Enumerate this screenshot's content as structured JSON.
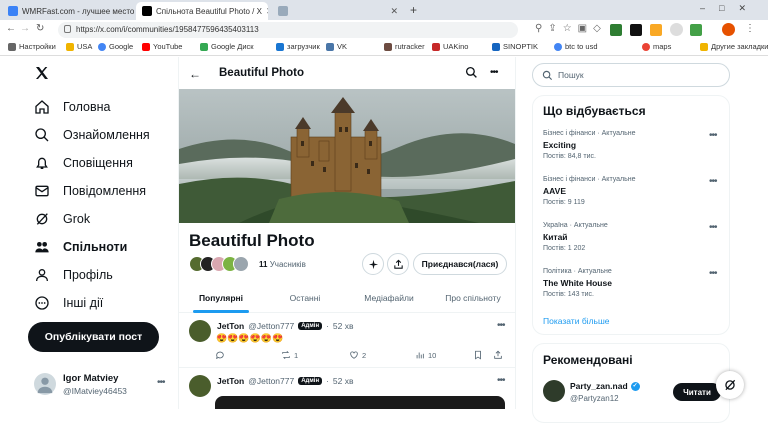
{
  "browser": {
    "tabs": [
      {
        "title": "WMRFast.com - лучшее место дл",
        "active": false
      },
      {
        "title": "Спільнота Beautiful Photo / X",
        "active": true
      },
      {
        "title": "",
        "active": false
      }
    ],
    "url": "https://x.com/i/communities/1958477596435403113",
    "bookmarks": [
      "Настройки",
      "USA",
      "Google",
      "YouTube",
      "Google Диск",
      "загрузчик",
      "VK",
      "rutracker",
      "UAKino",
      "SINOPTIK",
      "btc to usd",
      "maps",
      "Другие закладки"
    ]
  },
  "nav": {
    "items": [
      {
        "label": "Головна",
        "icon": "home-icon"
      },
      {
        "label": "Ознайомлення",
        "icon": "search-icon"
      },
      {
        "label": "Сповіщення",
        "icon": "bell-icon"
      },
      {
        "label": "Повідомлення",
        "icon": "mail-icon"
      },
      {
        "label": "Grok",
        "icon": "grok-icon"
      },
      {
        "label": "Спільноти",
        "icon": "communities-icon"
      },
      {
        "label": "Профіль",
        "icon": "person-icon"
      },
      {
        "label": "Інші дії",
        "icon": "more-circle-icon"
      }
    ],
    "post_button": "Опублікувати пост",
    "account": {
      "name": "Igor Matviey",
      "handle": "@IMatviey46453"
    }
  },
  "community": {
    "header_title": "Beautiful Photo",
    "name": "Beautiful Photo",
    "members": "11",
    "members_label": "Учасників",
    "joined_button": "Приєднався(лася)",
    "tabs": [
      "Популярні",
      "Останні",
      "Медіафайли",
      "Про спільноту"
    ],
    "active_tab": 0
  },
  "posts": [
    {
      "author": "JetTon",
      "handle": "@Jetton777",
      "badge": "Адмін",
      "time": "52 хв",
      "text": "😍😍😍😍😍😍",
      "stats": {
        "replies": "",
        "reposts": "1",
        "likes": "2",
        "views": "10"
      }
    },
    {
      "author": "JetTon",
      "handle": "@Jetton777",
      "badge": "Адмін",
      "time": "52 хв"
    }
  ],
  "search": {
    "placeholder": "Пошук"
  },
  "trends": {
    "title": "Що відбувається",
    "items": [
      {
        "context": "Бізнес і фінанси · Актуальне",
        "name": "Exciting",
        "count": "Постів: 84,8 тис."
      },
      {
        "context": "Бізнес і фінанси · Актуальне",
        "name": "AAVE",
        "count": "Постів: 9 119"
      },
      {
        "context": "Україна · Актуальне",
        "name": "Китай",
        "count": "Постів: 1 202"
      },
      {
        "context": "Політика · Актуальне",
        "name": "The White House",
        "count": "Постів: 143 тис."
      }
    ],
    "show_more": "Показати більше"
  },
  "recommended": {
    "title": "Рекомендовані",
    "user": {
      "name": "Party_zan.nad",
      "handle": "@Partyzan12",
      "button": "Читати"
    }
  },
  "colors": {
    "accent": "#1d9bf0",
    "text": "#0f1419",
    "muted": "#536471"
  }
}
